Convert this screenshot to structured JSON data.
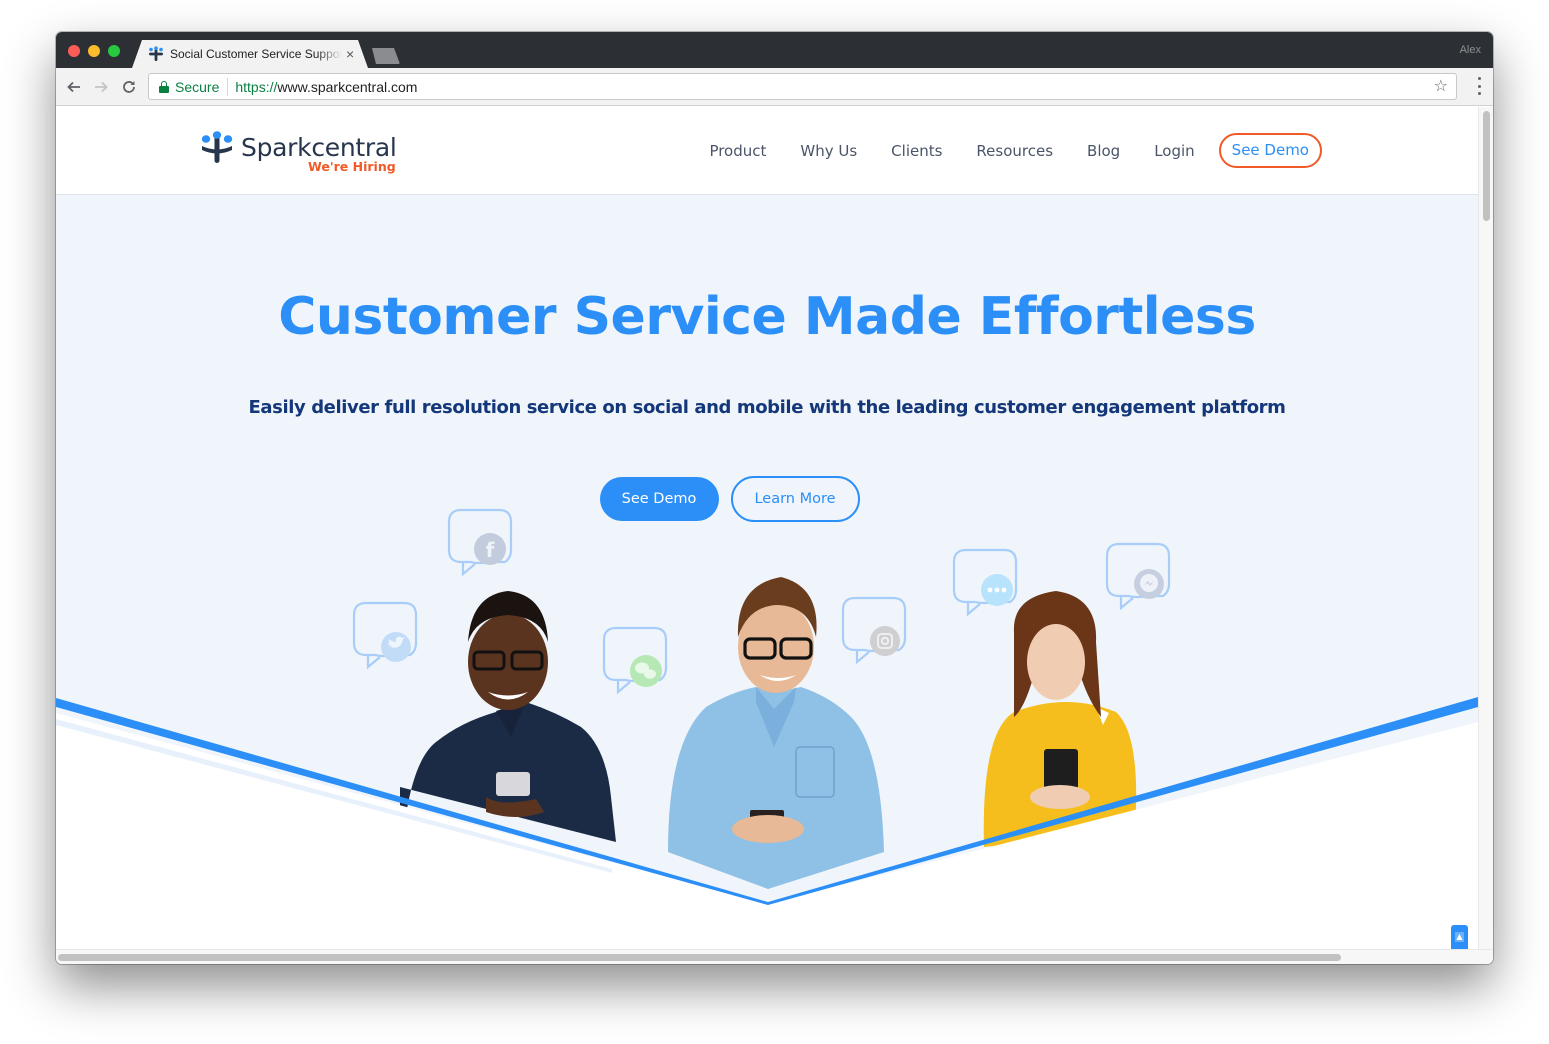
{
  "browser": {
    "tab_title": "Social Customer Service Support",
    "tab_close": "×",
    "profile_name": "Alex",
    "secure_label": "Secure",
    "url_scheme": "https://",
    "url_host": "www.sparkcentral.com",
    "icons": {
      "back": "arrow-left-icon",
      "forward": "arrow-right-icon",
      "reload": "reload-icon",
      "star": "star-icon",
      "menu": "more-vertical-icon",
      "lock": "lock-icon"
    }
  },
  "site": {
    "logo_text": "Sparkcentral",
    "hiring_label": "We're Hiring",
    "nav": [
      {
        "label": "Product"
      },
      {
        "label": "Why Us"
      },
      {
        "label": "Clients"
      },
      {
        "label": "Resources"
      },
      {
        "label": "Blog"
      },
      {
        "label": "Login"
      }
    ],
    "nav_cta": "See Demo",
    "colors": {
      "brand_blue": "#2b8ff7",
      "brand_navy": "#27364d",
      "accent_orange": "#f05a28",
      "hero_bg": "#eff5fb"
    }
  },
  "hero": {
    "title": "Customer Service Made Effortless",
    "subtitle": "Easily deliver full resolution service on social and mobile with the leading customer engagement platform",
    "primary_cta": "See Demo",
    "secondary_cta": "Learn More",
    "bubbles": [
      {
        "channel": "facebook",
        "icon": "facebook-icon",
        "glyph": "f"
      },
      {
        "channel": "twitter",
        "icon": "twitter-icon",
        "glyph": ""
      },
      {
        "channel": "wechat",
        "icon": "wechat-icon",
        "glyph": ""
      },
      {
        "channel": "instagram",
        "icon": "instagram-icon",
        "glyph": ""
      },
      {
        "channel": "sms",
        "icon": "chat-dots-icon",
        "glyph": "•••"
      },
      {
        "channel": "messenger",
        "icon": "messenger-icon",
        "glyph": ""
      }
    ],
    "people": [
      {
        "name": "person-dark-shirt"
      },
      {
        "name": "person-denim-shirt"
      },
      {
        "name": "person-yellow-sweater"
      }
    ]
  },
  "widgets": {
    "scroll_top_icon": "arrow-up-icon"
  }
}
